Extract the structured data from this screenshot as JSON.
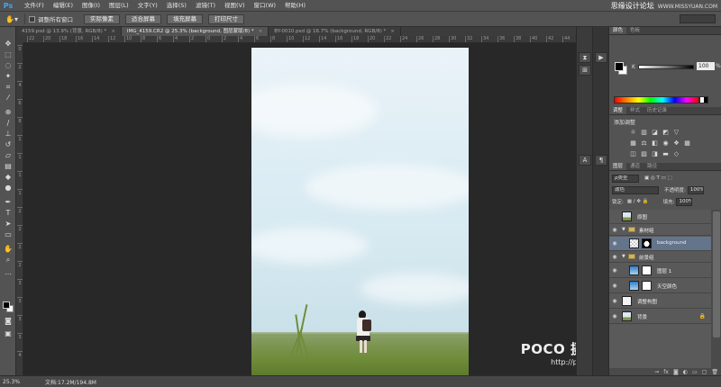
{
  "app": {
    "logo": "Ps",
    "menu": [
      "文件(F)",
      "编辑(E)",
      "图像(I)",
      "图层(L)",
      "文字(Y)",
      "选择(S)",
      "滤镜(T)",
      "视图(V)",
      "窗口(W)",
      "帮助(H)"
    ],
    "brand": "思缘设计论坛",
    "brand_url": "WWW.MISSYUAN.COM"
  },
  "options": {
    "checkbox_label": "调整所有窗口",
    "buttons": [
      "实际像素",
      "适合屏幕",
      "填充屏幕",
      "打印尺寸"
    ]
  },
  "tabs": [
    {
      "label": "4159.psd @ 13.9% (背景, RGB/8) *",
      "active": false
    },
    {
      "label": "IMG_4159.CR2 @ 25.3% (background, 图层蒙版/8) *",
      "active": true
    },
    {
      "label": "BY-0010.psd @ 16.7% (background, RGB/8) *",
      "active": false
    }
  ],
  "ruler": {
    "h": [
      "22",
      "20",
      "18",
      "16",
      "14",
      "12",
      "10",
      "8",
      "6",
      "4",
      "2",
      "0",
      "2",
      "4",
      "6",
      "8",
      "10",
      "12",
      "14",
      "16",
      "18",
      "20",
      "22",
      "24",
      "26",
      "28",
      "30",
      "32",
      "34",
      "36",
      "38",
      "40",
      "42",
      "44"
    ],
    "v": [
      "0",
      "2",
      "4",
      "6",
      "8",
      "1",
      "1",
      "1",
      "1",
      "2",
      "2",
      "2",
      "2",
      "3",
      "3",
      "3",
      "3",
      "4"
    ]
  },
  "status": {
    "zoom": "25.3%",
    "doc": "文档:17.2M/194.8M"
  },
  "watermark": {
    "logo": "POCO 摄影专题",
    "url": "http://photo.poco.cn/"
  },
  "color_panel": {
    "tabs": [
      "颜色",
      "色板"
    ],
    "channel": "K",
    "value": "100",
    "unit": "%"
  },
  "adjust_panel": {
    "tabs": [
      "调整",
      "样式",
      "历史记录"
    ],
    "title": "添加调整"
  },
  "layers_panel": {
    "tabs": [
      "图层",
      "通道",
      "路径"
    ],
    "filter": "ρ类型",
    "blend_mode": "滤色",
    "opacity_label": "不透明度:",
    "opacity": "100%",
    "lock_label": "锁定:",
    "fill_label": "填充:",
    "fill": "100%",
    "layers": [
      {
        "name": "原图",
        "type": "layer",
        "indent": 0,
        "visible": false,
        "thumb": "photo"
      },
      {
        "name": "素材组",
        "type": "group",
        "indent": 0,
        "visible": true
      },
      {
        "name": "background",
        "type": "layer",
        "indent": 1,
        "visible": true,
        "thumb": "transparent",
        "mask": true,
        "selected": true
      },
      {
        "name": "前景组",
        "type": "group",
        "indent": 0,
        "visible": true
      },
      {
        "name": "图层 1",
        "type": "layer",
        "indent": 1,
        "visible": true,
        "thumb": "blue",
        "mask": true
      },
      {
        "name": "天空颜色",
        "type": "layer",
        "indent": 1,
        "visible": true,
        "thumb": "blue",
        "mask": true
      },
      {
        "name": "调整构图",
        "type": "layer",
        "indent": 0,
        "visible": true,
        "thumb": "white"
      },
      {
        "name": "背景",
        "type": "layer",
        "indent": 0,
        "visible": true,
        "thumb": "photo",
        "locked": true
      }
    ]
  },
  "colors": {
    "accent": "#38a8f8",
    "selected_layer": "#64748a"
  }
}
